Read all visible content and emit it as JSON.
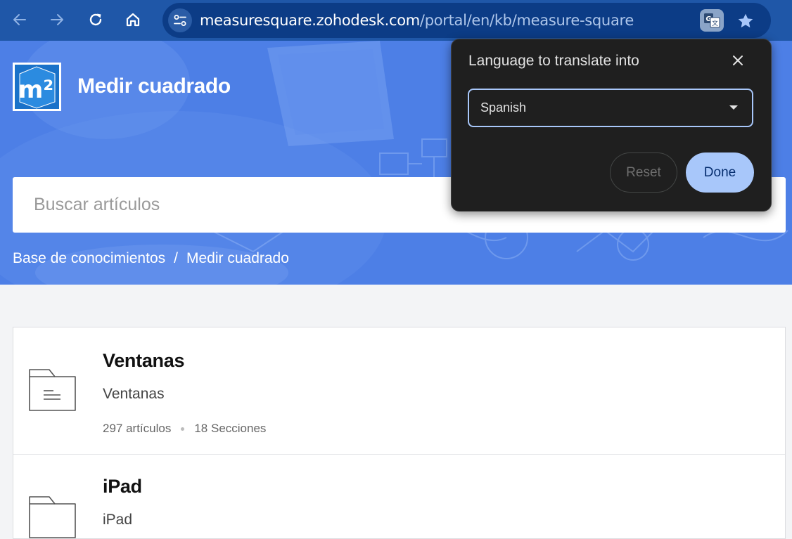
{
  "browser": {
    "url_host": "measuresquare.zohodesk.com",
    "url_path": "/portal/en/kb/measure-square",
    "icons": {
      "back": "arrow-left-icon",
      "forward": "arrow-right-icon",
      "reload": "reload-icon",
      "home": "home-icon",
      "site_info": "tune-icon",
      "translate": "translate-icon",
      "bookmark": "star-icon"
    }
  },
  "site": {
    "title": "Medir cuadrado",
    "logo_text": "m²"
  },
  "search": {
    "placeholder": "Buscar artículos"
  },
  "breadcrumb": {
    "items": [
      "Base de conocimientos",
      "Medir cuadrado"
    ],
    "separator": "/"
  },
  "categories": [
    {
      "title": "Ventanas",
      "description": "Ventanas",
      "articles": "297 artículos",
      "sections": "18 Secciones"
    },
    {
      "title": "iPad",
      "description": "iPad"
    }
  ],
  "translate_popup": {
    "title": "Language to translate into",
    "selected_language": "Spanish",
    "reset_label": "Reset",
    "done_label": "Done"
  },
  "colors": {
    "toolbar": "#1f57a8",
    "omnibox": "#0c3c86",
    "hero": "#4d7fe6",
    "popup_bg": "#1f1f1f",
    "accent": "#a8c7fa"
  }
}
